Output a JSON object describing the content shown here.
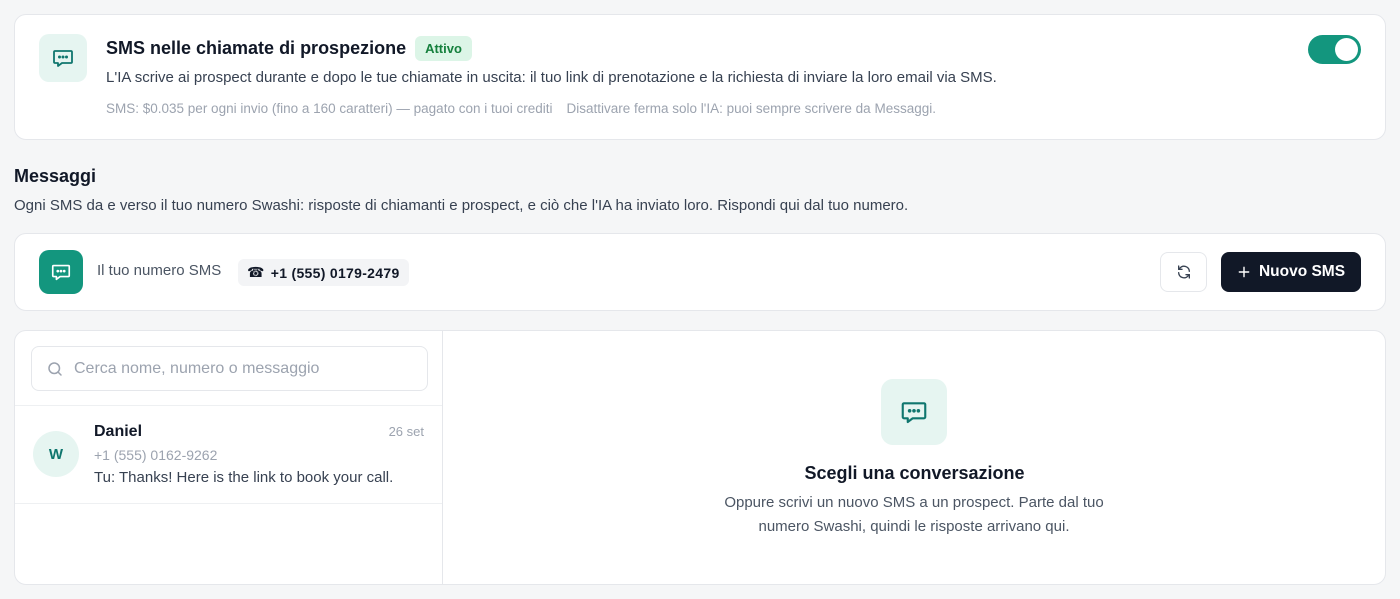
{
  "ai_sms": {
    "title": "SMS nelle chiamate di prospezione",
    "badge": "Attivo",
    "description": "L'IA scrive ai prospect durante e dopo le tue chiamate in uscita: il tuo link di prenotazione e la richiesta di inviare la loro email via SMS.",
    "pricing_note": "SMS: $0.035 per ogni invio (fino a 160 caratteri) — pagato con i tuoi crediti",
    "disable_note": "Disattivare ferma solo l'IA: puoi sempre scrivere da Messaggi.",
    "enabled": true,
    "icon": "chat-bubble-icon"
  },
  "messages": {
    "title": "Messaggi",
    "description": "Ogni SMS da e verso il tuo numero Swashi: risposte di chiamanti e prospect, e ciò che l'IA ha inviato loro. Rispondi qui dal tuo numero."
  },
  "number_bar": {
    "label": "Il tuo numero SMS",
    "phone_glyph": "☎",
    "number": "+1 (555) 0179-2479",
    "new_sms_label": "Nuovo SMS",
    "refresh_icon": "refresh-icon",
    "plus_icon": "plus-icon"
  },
  "search": {
    "placeholder": "Cerca nome, numero o messaggio",
    "value": ""
  },
  "conversations": [
    {
      "avatar": "W",
      "name": "Daniel",
      "date": "26 set",
      "phone": "+1 (555) 0162-9262",
      "preview": "Tu: Thanks! Here is the link to book your call."
    }
  ],
  "empty_state": {
    "title": "Scegli una conversazione",
    "description": "Oppure scrivi un nuovo SMS a un prospect. Parte dal tuo numero Swashi, quindi le risposte arrivano qui."
  },
  "colors": {
    "accent": "#13967e",
    "accent_light": "#e6f5f1",
    "badge_bg": "#dcf5e7",
    "badge_text": "#15803d",
    "dark_button": "#111827"
  }
}
